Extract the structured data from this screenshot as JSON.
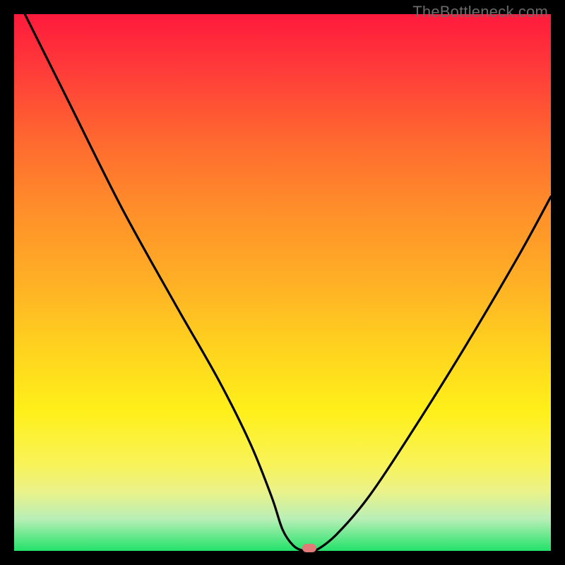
{
  "watermark": "TheBottleneck.com",
  "chart_data": {
    "type": "line",
    "title": "",
    "xlabel": "",
    "ylabel": "",
    "xlim": [
      0,
      100
    ],
    "ylim": [
      0,
      100
    ],
    "grid": false,
    "legend": false,
    "series": [
      {
        "name": "curve",
        "x": [
          2,
          10,
          20,
          30,
          38,
          44,
          48,
          50,
          52,
          54,
          56,
          60,
          66,
          74,
          84,
          94,
          100
        ],
        "y": [
          100,
          84,
          64,
          46,
          32,
          20,
          10,
          4,
          1,
          0,
          0,
          3,
          10,
          22,
          38,
          55,
          66
        ]
      }
    ],
    "marker": {
      "x": 55,
      "y": 0.5,
      "shape": "pill",
      "color": "#e17b79"
    },
    "background_gradient": {
      "direction": "vertical",
      "stops": [
        {
          "pos": 0,
          "color": "#ff1a3c"
        },
        {
          "pos": 50,
          "color": "#ffb025"
        },
        {
          "pos": 80,
          "color": "#fff01a"
        },
        {
          "pos": 100,
          "color": "#23e26a"
        }
      ]
    }
  }
}
